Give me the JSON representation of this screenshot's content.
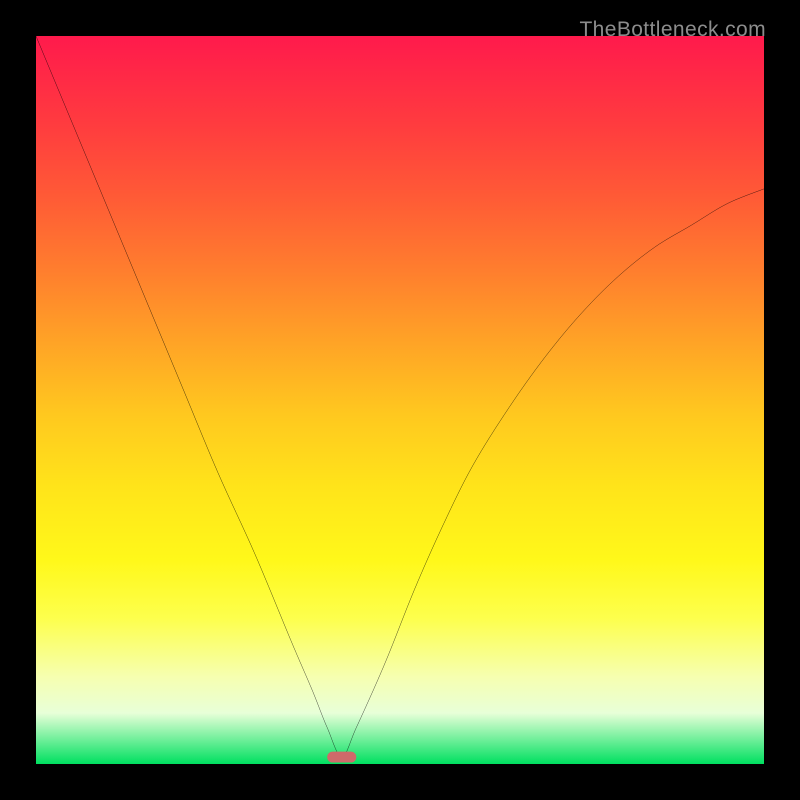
{
  "watermark": "TheBottleneck.com",
  "chart_data": {
    "type": "line",
    "title": "",
    "xlabel": "",
    "ylabel": "",
    "xlim": [
      0,
      100
    ],
    "ylim": [
      0,
      100
    ],
    "grid": false,
    "legend": false,
    "series": [
      {
        "name": "bottleneck-curve",
        "x": [
          0,
          5,
          10,
          15,
          20,
          25,
          30,
          35,
          38,
          40,
          42,
          44,
          48,
          52,
          56,
          60,
          65,
          70,
          75,
          80,
          85,
          90,
          95,
          100
        ],
        "values": [
          100,
          88,
          76,
          64,
          52,
          40,
          29,
          17,
          10,
          5,
          1,
          5,
          14,
          24,
          33,
          41,
          49,
          56,
          62,
          67,
          71,
          74,
          77,
          79
        ]
      }
    ],
    "marker": {
      "x": 42,
      "y": 0,
      "color": "#cf6a6a",
      "shape": "pill"
    },
    "background_gradient": {
      "top": "#ff1a4c",
      "mid": "#ffe41a",
      "bottom": "#00e060"
    }
  }
}
